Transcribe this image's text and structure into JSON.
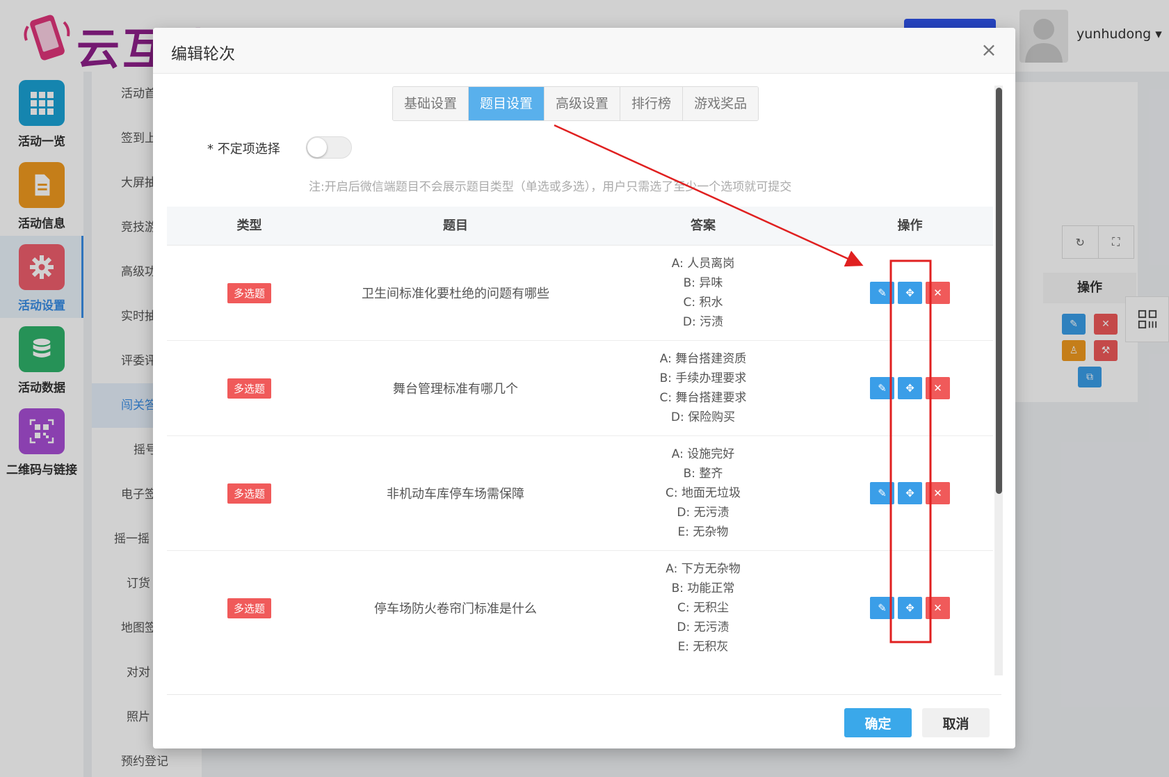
{
  "app": {
    "logo_text": "云互动",
    "user_name": "yunhudong",
    "caret": "▾"
  },
  "leftnav": [
    {
      "label": "活动一览",
      "icon": "grid-icon",
      "color": "#1aa3d6"
    },
    {
      "label": "活动信息",
      "icon": "document-icon",
      "color": "#f19a1f"
    },
    {
      "label": "活动设置",
      "icon": "gear-icon",
      "color": "#f05f6d"
    },
    {
      "label": "活动数据",
      "icon": "database-icon",
      "color": "#2fb36b"
    },
    {
      "label": "二维码与链接",
      "icon": "qrcode-icon",
      "color": "#a94fd6"
    }
  ],
  "subnav": [
    "活动首",
    "签到上",
    "大屏抽",
    "竞技游",
    "高级功",
    "实时抽",
    "评委评",
    "闯关答",
    "摇号",
    "电子签",
    "摇一摇",
    "订货",
    "地图签",
    "对对",
    "照片",
    "预约登记"
  ],
  "modal": {
    "title": "编辑轮次",
    "close": "×",
    "tabs": [
      "基础设置",
      "题目设置",
      "高级设置",
      "排行榜",
      "游戏奖品"
    ],
    "active_tab": 1,
    "option_label": "* 不定项选择",
    "note": "注:开启后微信端题目不会展示题目类型（单选或多选），用户只需选了至少一个选项就可提交",
    "table": {
      "headers": [
        "类型",
        "题目",
        "答案",
        "操作"
      ],
      "rows": [
        {
          "type": "多选题",
          "question": "卫生间标准化要杜绝的问题有哪些",
          "answers": [
            "A: 人员离岗",
            "B: 异味",
            "C: 积水",
            "D: 污渍"
          ]
        },
        {
          "type": "多选题",
          "question": "舞台管理标准有哪几个",
          "answers": [
            "A: 舞台搭建资质",
            "B: 手续办理要求",
            "C: 舞台搭建要求",
            "D: 保险购买"
          ]
        },
        {
          "type": "多选题",
          "question": "非机动车库停车场需保障",
          "answers": [
            "A: 设施完好",
            "B: 整齐",
            "C: 地面无垃圾",
            "D: 无污渍",
            "E: 无杂物"
          ]
        },
        {
          "type": "多选题",
          "question": "停车场防火卷帘门标准是什么",
          "answers": [
            "A: 下方无杂物",
            "B: 功能正常",
            "C: 无积尘",
            "D: 无污渍",
            "E: 无积灰"
          ]
        }
      ]
    },
    "ok_label": "确定",
    "cancel_label": "取消"
  },
  "background": {
    "op_header": "操作"
  },
  "colors": {
    "accent": "#3a9ee8",
    "danger": "#f05a5a",
    "annotation": "#e02020"
  }
}
